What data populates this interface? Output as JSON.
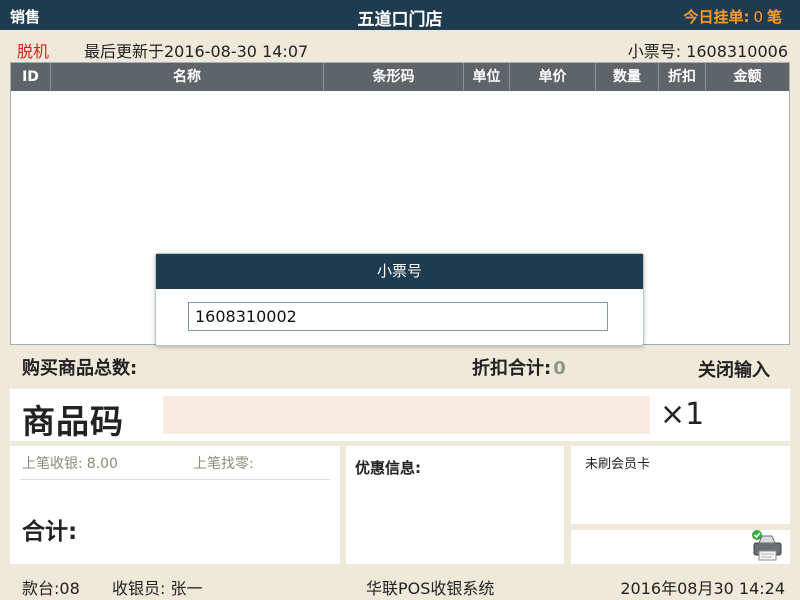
{
  "header": {
    "mode": "销售",
    "store_name": "五道口门店",
    "held_label": "今日挂单:",
    "held_count": "0",
    "held_unit": "笔"
  },
  "status": {
    "connection": "脱机",
    "last_updated": "最后更新于2016-08-30 14:07",
    "ticket_no": "小票号: 1608310006"
  },
  "table": {
    "columns": [
      "ID",
      "名称",
      "条形码",
      "单位",
      "单价",
      "数量",
      "折扣",
      "金额"
    ],
    "rows": []
  },
  "dialog": {
    "title": "小票号",
    "input_value": "1608310002"
  },
  "summary": {
    "total_items_label": "购买商品总数:",
    "discount_label": "折扣合计:",
    "discount_value": "0",
    "close_input_label": "关闭输入"
  },
  "entry": {
    "code_label": "商品码",
    "code_value": "",
    "multiplier": "×1"
  },
  "payment": {
    "last_received_label": "上笔收银:",
    "last_received_value": "8.00",
    "last_change_label": "上笔找零:",
    "total_label": "合计:"
  },
  "promo": {
    "label": "优惠信息:"
  },
  "member": {
    "text": "未刷会员卡"
  },
  "footer": {
    "station": "款台:08",
    "cashier": "收银员: 张一",
    "system_name": "华联POS收银系统",
    "datetime": "2016年08月30 14:24"
  },
  "colors": {
    "header_bg": "#1f3b50",
    "accent_orange": "#ff9a2e",
    "offline_red": "#d8201c",
    "table_header_bg": "#5e6468",
    "code_input_bg": "#f9ebe0",
    "page_bg": "#efe9d9"
  }
}
